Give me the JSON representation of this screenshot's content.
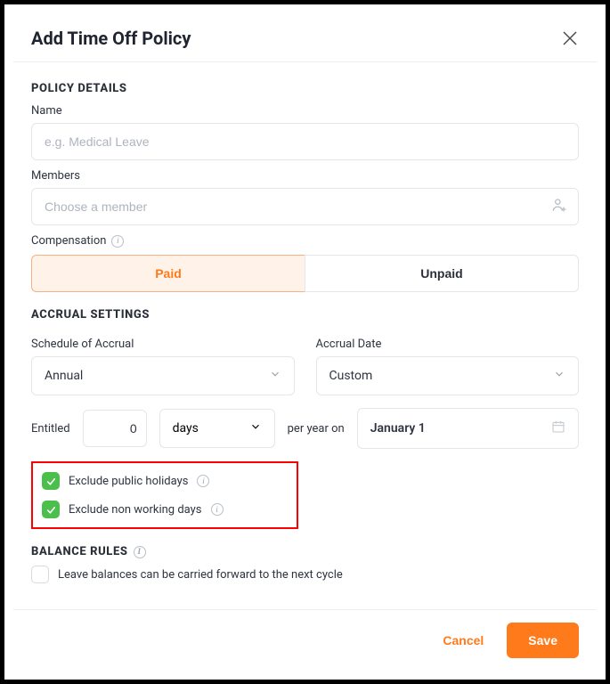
{
  "header": {
    "title": "Add Time Off Policy"
  },
  "policy_details": {
    "section_title": "POLICY DETAILS",
    "name_label": "Name",
    "name_placeholder": "e.g. Medical Leave",
    "name_value": "",
    "members_label": "Members",
    "members_placeholder": "Choose a member",
    "members_value": "",
    "compensation_label": "Compensation",
    "paid_label": "Paid",
    "unpaid_label": "Unpaid",
    "compensation_selected": "paid"
  },
  "accrual": {
    "section_title": "ACCRUAL SETTINGS",
    "schedule_label": "Schedule of Accrual",
    "schedule_value": "Annual",
    "date_label": "Accrual Date",
    "date_mode_value": "Custom",
    "entitled_label": "Entitled",
    "entitled_value": "0",
    "unit_value": "days",
    "per_year_label": "per year on",
    "accrual_date_value": "January 1",
    "exclude_holidays_label": "Exclude public holidays",
    "exclude_holidays_checked": true,
    "exclude_nonworking_label": "Exclude non working days",
    "exclude_nonworking_checked": true
  },
  "balance": {
    "section_title": "BALANCE RULES",
    "carry_forward_label": "Leave balances can be carried forward to the next cycle",
    "carry_forward_checked": false
  },
  "footer": {
    "cancel_label": "Cancel",
    "save_label": "Save"
  }
}
